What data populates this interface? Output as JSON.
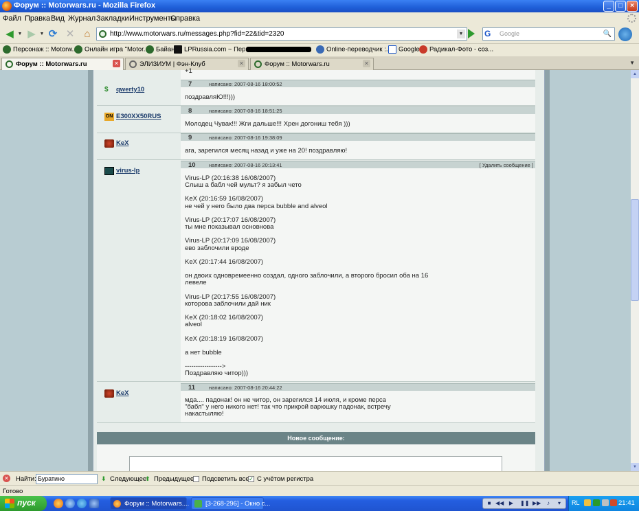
{
  "window": {
    "title": "Форум :: Motorwars.ru - Mozilla Firefox"
  },
  "menu": [
    "Файл",
    "Правка",
    "Вид",
    "Журнал",
    "Закладки",
    "Инструменты",
    "Справка"
  ],
  "nav": {
    "url": "http://www.motorwars.ru/messages.php?fid=22&tid=2320",
    "search_placeholder": "Google",
    "search_engine": "G"
  },
  "bookmarks": [
    "Персонаж :: Motorw...",
    "Онлайн игра \"Motor...",
    "Байан",
    "LPRussia.com ~ Пере...",
    "Online-переводчик :...",
    "Google",
    "Радикал-Фото - соз..."
  ],
  "tabs": [
    {
      "label": "Форум :: Motorwars.ru",
      "active": true
    },
    {
      "label": "ЭЛИЗИУМ | Фэн-Клуб",
      "active": false
    },
    {
      "label": "Форум :: Motorwars.ru",
      "active": false
    }
  ],
  "forum": {
    "top_fragment": "+1",
    "posts": [
      {
        "num": "7",
        "date": "написано: 2007-08-16 18:00:52",
        "user": "qwerty10",
        "icon_color": "#2a8a2a",
        "text": "поздравляЮ!!!)))",
        "delete": ""
      },
      {
        "num": "8",
        "date": "написано: 2007-08-16 18:51:25",
        "user": "E300XX50RUS",
        "icon_color": "#e8a82a",
        "text": "Молодец Чувак!!! Жги дальше!!! Хрен догониш тебя )))",
        "delete": ""
      },
      {
        "num": "9",
        "date": "написано: 2007-08-16 19:38:09",
        "user": "KeX",
        "icon_color": "#8a2a12",
        "text": "ага, зарегился месяц назад и уже на 20! поздравляю!",
        "delete": ""
      },
      {
        "num": "10",
        "date": "написано: 2007-08-16 20:13:41",
        "user": "virus-lp",
        "icon_color": "#1a4a4a",
        "delete": "[ Удалить сообщение ]",
        "text": "Virus-LP (20:16:38 16/08/2007)\nСлыш а бабл чей мульт? я забыл чето\n\nKeX (20:16:59 16/08/2007)\nне чей у него было два перса bubble and alveol\n\nVirus-LP (20:17:07 16/08/2007)\nты мне показывал основнова\n\nVirus-LP (20:17:09 16/08/2007)\nево заблочили вроде\n\nKeX (20:17:44 16/08/2007)\n\nон двоих одновремеенно создал, одного заблочили, а второго бросил оба на 16\nлевеле\n\nVirus-LP (20:17:55 16/08/2007)\nкоторова заблочили дай ник\n\nKeX (20:18:02 16/08/2007)\nalveol\n\nKeX (20:18:19 16/08/2007)\n\nа нет bubble\n\n----------------->\nПоздравляю читор)))"
      },
      {
        "num": "11",
        "date": "написано: 2007-08-16 20:44:22",
        "user": "KeX",
        "icon_color": "#8a2a12",
        "text": "мда.... падонак! он не читор, он зарегился 14 июля, и кроме перса\n\"бабл\" у него никого нет! так что прикрой варюшку падонак, встречу\nнакастыляю!",
        "delete": ""
      }
    ],
    "new_message": "Новое сообщение:"
  },
  "findbar": {
    "label": "Найти:",
    "value": "Буратино",
    "next": "Следующее",
    "prev": "Предыдущее",
    "highlight": "Подсветить все",
    "match_case": "С учётом регистра"
  },
  "status": "Готово",
  "taskbar": {
    "start": "пуск",
    "tasks": [
      {
        "label": "Форум :: Motorwars....",
        "active": true
      },
      {
        "label": "[3-268-296] - Окно с...",
        "active": false
      }
    ],
    "lang": "RL",
    "clock": "21:41"
  }
}
